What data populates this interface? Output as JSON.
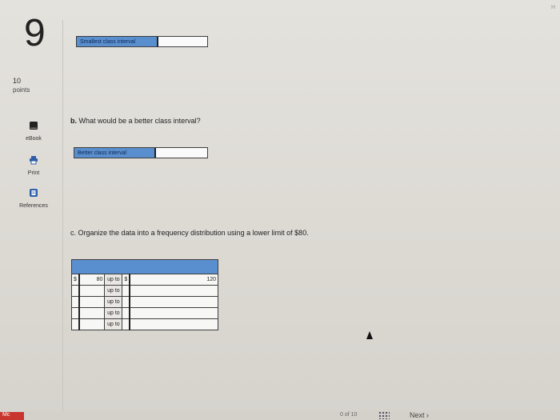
{
  "question": {
    "number": "9",
    "points_value": "10",
    "points_label": "points"
  },
  "tools": {
    "ebook": "eBook",
    "print": "Print",
    "references": "References"
  },
  "part_a": {
    "field_label": "Smallest class interval",
    "value": ""
  },
  "part_b": {
    "letter": "b.",
    "prompt": "What would be a better class interval?",
    "field_label": "Better class interval",
    "value": ""
  },
  "part_c": {
    "letter": "c.",
    "prompt": "Organize the data into a frequency distribution using a lower limit of $80.",
    "table": {
      "rows": [
        {
          "cur1": "$",
          "low": "80",
          "upto": "up to",
          "cur2": "$",
          "high": "120"
        },
        {
          "cur1": "",
          "low": "",
          "upto": "up to",
          "cur2": "",
          "high": ""
        },
        {
          "cur1": "",
          "low": "",
          "upto": "up to",
          "cur2": "",
          "high": ""
        },
        {
          "cur1": "",
          "low": "",
          "upto": "up to",
          "cur2": "",
          "high": ""
        },
        {
          "cur1": "",
          "low": "",
          "upto": "up to",
          "cur2": "",
          "high": ""
        }
      ]
    }
  },
  "footer": {
    "logo": "Mc",
    "page_indicator": "0 of 10",
    "next_label": "Next",
    "next_chevron": "›"
  },
  "corner_text": "H",
  "colors": {
    "accent_blue": "#5a8fcf",
    "logo_red": "#c8352e"
  }
}
